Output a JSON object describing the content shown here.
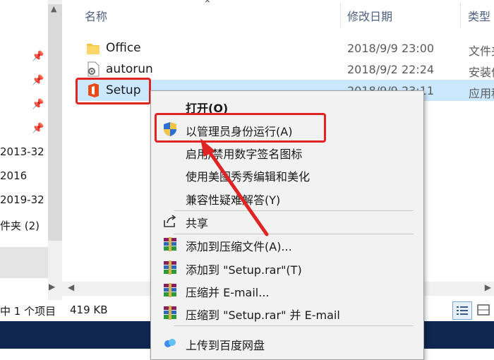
{
  "columns": {
    "name": "名称",
    "modified": "修改日期",
    "type": "类型"
  },
  "files": [
    {
      "name": "Office",
      "date": "2018/9/9 23:00",
      "type": "文件夹",
      "icon": "folder-icon"
    },
    {
      "name": "autorun",
      "date": "2018/9/2 22:24",
      "type": "安装信息",
      "icon": "settings-file-icon"
    },
    {
      "name": "Setup",
      "date": "2018/9/9 23:11",
      "type": "应用程序",
      "icon": "office-logo-icon",
      "selected": true
    }
  ],
  "nav": {
    "items": [
      "2013-32",
      "2016",
      "2019-32",
      "件夹 (2)"
    ]
  },
  "context_menu": {
    "items": [
      {
        "label": "打开(O)",
        "bold": true
      },
      {
        "label": "以管理员身份运行(A)",
        "icon": "uac-shield-icon",
        "highlighted": true
      },
      {
        "label": "启用/禁用数字签名图标"
      },
      {
        "label": "使用美图秀秀编辑和美化"
      },
      {
        "label": "兼容性疑难解答(Y)"
      },
      {
        "label": "共享",
        "icon": "share-icon"
      },
      {
        "label": "添加到压缩文件(A)...",
        "icon": "winrar-icon"
      },
      {
        "label": "添加到 \"Setup.rar\"(T)",
        "icon": "winrar-icon"
      },
      {
        "label": "压缩并 E-mail...",
        "icon": "winrar-icon"
      },
      {
        "label": "压缩到 \"Setup.rar\" 并 E-mail",
        "icon": "winrar-icon"
      },
      {
        "label": "上传到百度网盘",
        "icon": "baidu-netdisk-icon"
      }
    ]
  },
  "status": {
    "selection": "中 1 个项目",
    "size": "419 KB"
  },
  "colors": {
    "selected_row": "#cce8ff",
    "highlight_red": "#e02424",
    "menu_bg": "#f2f2f2",
    "taskbar": "#0e2650"
  }
}
